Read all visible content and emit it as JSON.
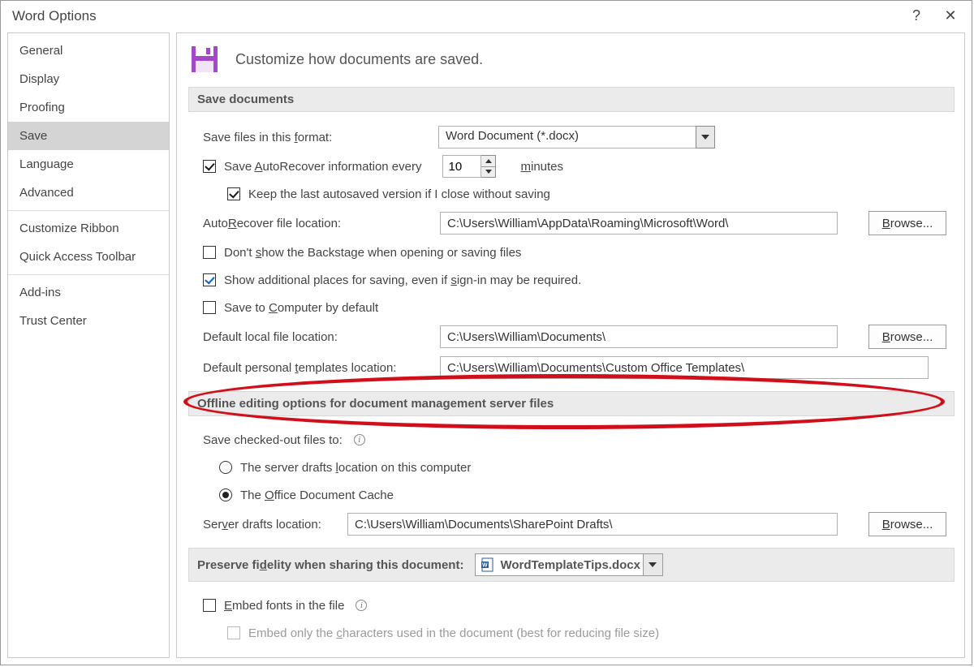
{
  "window": {
    "title": "Word Options"
  },
  "sidebar": {
    "items": [
      "General",
      "Display",
      "Proofing",
      "Save",
      "Language",
      "Advanced",
      "Customize Ribbon",
      "Quick Access Toolbar",
      "Add-ins",
      "Trust Center"
    ],
    "selected_index": 3
  },
  "header": {
    "text": "Customize how documents are saved."
  },
  "sections": {
    "save_documents": {
      "title": "Save documents",
      "format_label": "Save files in this format:",
      "format_value": "Word Document (*.docx)",
      "autorecover_label_pre": "Save AutoRecover information every",
      "autorecover_minutes": "10",
      "autorecover_label_post": "minutes",
      "autorecover_checked": true,
      "keep_last_label": "Keep the last autosaved version if I close without saving",
      "keep_last_checked": true,
      "autorecover_loc_label": "AutoRecover file location:",
      "autorecover_loc_value": "C:\\Users\\William\\AppData\\Roaming\\Microsoft\\Word\\",
      "dont_show_backstage_label": "Don't show the Backstage when opening or saving files",
      "dont_show_backstage_checked": false,
      "show_additional_places_label": "Show additional places for saving, even if sign-in may be required.",
      "show_additional_places_checked": true,
      "save_to_computer_label": "Save to Computer by default",
      "save_to_computer_checked": false,
      "default_local_label": "Default local file location:",
      "default_local_value": "C:\\Users\\William\\Documents\\",
      "default_templates_label": "Default personal templates location:",
      "default_templates_value": "C:\\Users\\William\\Documents\\Custom Office Templates\\",
      "browse_label": "Browse..."
    },
    "offline": {
      "title": "Offline editing options for document management server files",
      "save_checked_out_label": "Save checked-out files to:",
      "radio_server_drafts": "The server drafts location on this computer",
      "radio_office_cache": "The Office Document Cache",
      "selected_radio": 1,
      "server_drafts_label": "Server drafts location:",
      "server_drafts_value": "C:\\Users\\William\\Documents\\SharePoint Drafts\\",
      "browse_label": "Browse..."
    },
    "preserve": {
      "title": "Preserve fidelity when sharing this document:",
      "doc_name": "WordTemplateTips.docx",
      "embed_fonts_label": "Embed fonts in the file",
      "embed_fonts_checked": false,
      "embed_chars_label": "Embed only the characters used in the document (best for reducing file size)"
    }
  }
}
